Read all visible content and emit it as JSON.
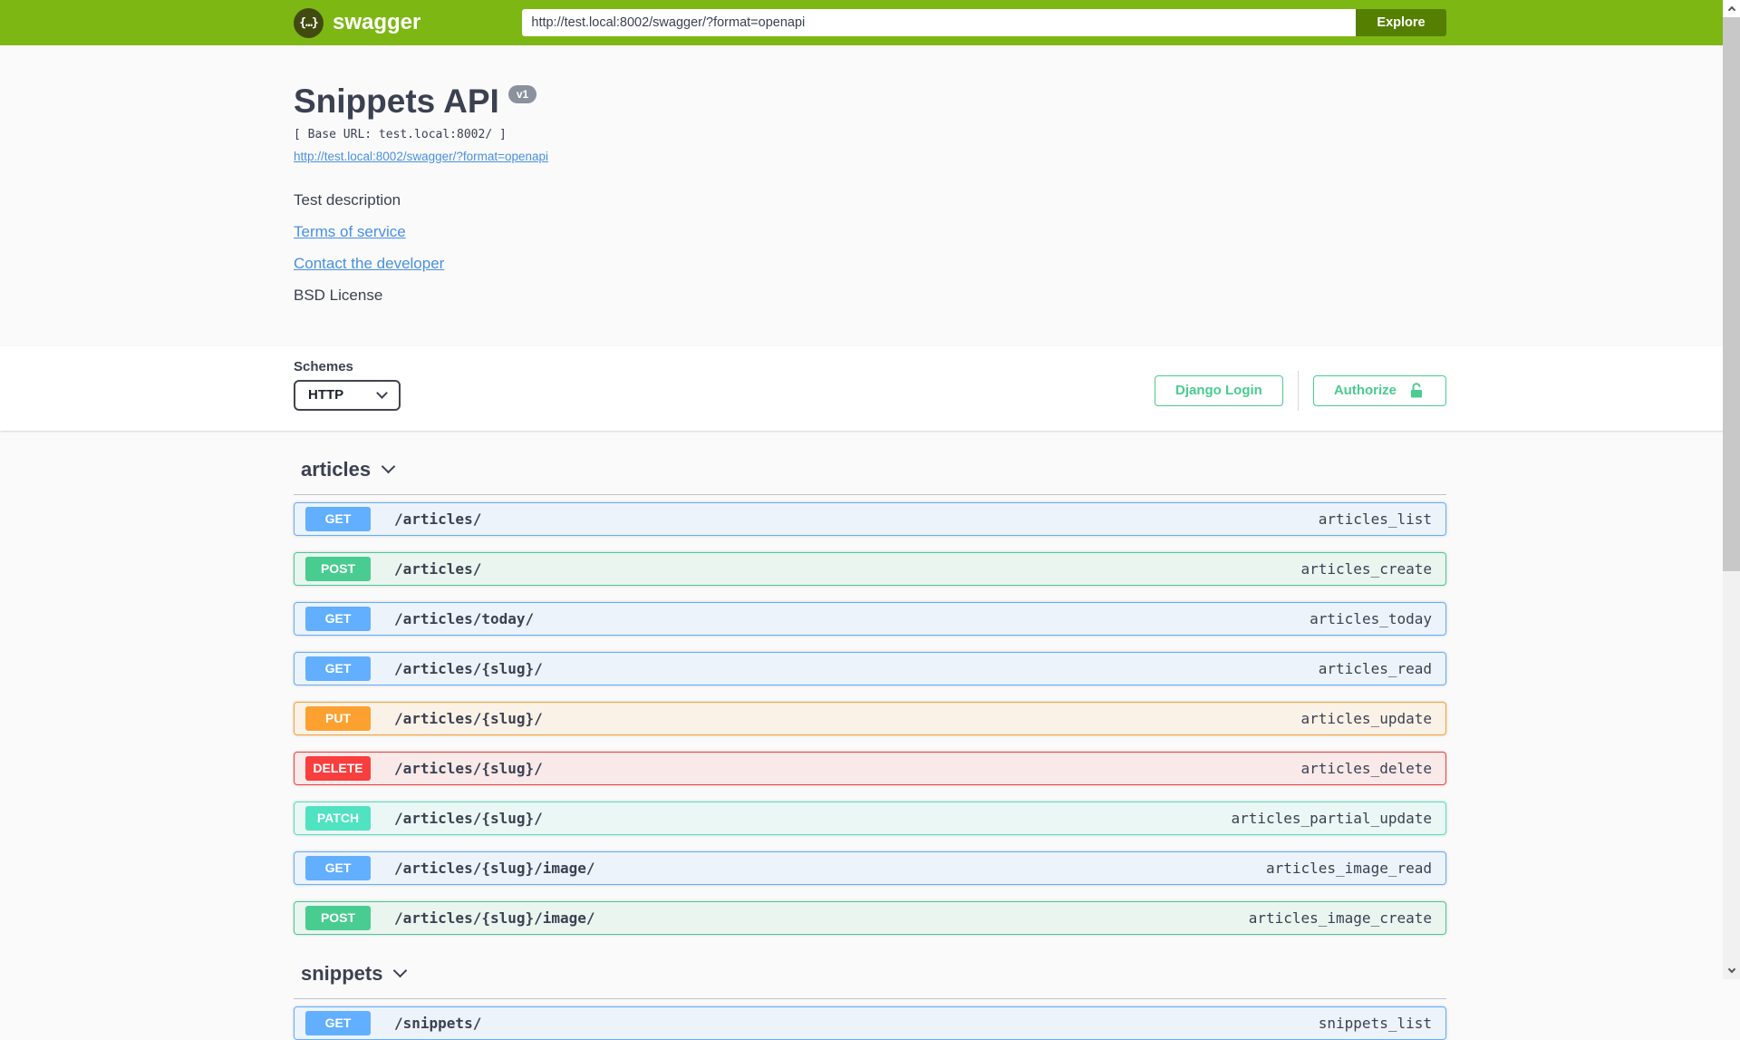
{
  "topbar": {
    "brand": "swagger",
    "logo_glyph": "{…}",
    "url_value": "http://test.local:8002/swagger/?format=openapi",
    "explore_label": "Explore"
  },
  "info": {
    "title": "Snippets API",
    "version_badge": "v1",
    "base_url_line": "[ Base URL: test.local:8002/ ]",
    "spec_link": "http://test.local:8002/swagger/?format=openapi",
    "description": "Test description",
    "terms_link": "Terms of service",
    "contact_link": "Contact the developer",
    "license": "BSD License"
  },
  "schemes": {
    "label": "Schemes",
    "selected": "HTTP"
  },
  "auth": {
    "django_login_label": "Django Login",
    "authorize_label": "Authorize"
  },
  "colors": {
    "topbar_bg": "#7db714",
    "explore_btn_bg": "#547f00",
    "link": "#4990e2",
    "text_dark": "#3b4151",
    "auth_green": "#49cc90",
    "methods": {
      "GET": "#61affe",
      "POST": "#49cc90",
      "PUT": "#fca130",
      "DELETE": "#f93e3e",
      "PATCH": "#50e3c2"
    }
  },
  "sections": [
    {
      "tag": "articles",
      "operations": [
        {
          "method": "GET",
          "path": "/articles/",
          "operation_id": "articles_list"
        },
        {
          "method": "POST",
          "path": "/articles/",
          "operation_id": "articles_create"
        },
        {
          "method": "GET",
          "path": "/articles/today/",
          "operation_id": "articles_today"
        },
        {
          "method": "GET",
          "path": "/articles/{slug}/",
          "operation_id": "articles_read"
        },
        {
          "method": "PUT",
          "path": "/articles/{slug}/",
          "operation_id": "articles_update"
        },
        {
          "method": "DELETE",
          "path": "/articles/{slug}/",
          "operation_id": "articles_delete"
        },
        {
          "method": "PATCH",
          "path": "/articles/{slug}/",
          "operation_id": "articles_partial_update"
        },
        {
          "method": "GET",
          "path": "/articles/{slug}/image/",
          "operation_id": "articles_image_read"
        },
        {
          "method": "POST",
          "path": "/articles/{slug}/image/",
          "operation_id": "articles_image_create"
        }
      ]
    },
    {
      "tag": "snippets",
      "operations": [
        {
          "method": "GET",
          "path": "/snippets/",
          "operation_id": "snippets_list"
        }
      ]
    }
  ]
}
